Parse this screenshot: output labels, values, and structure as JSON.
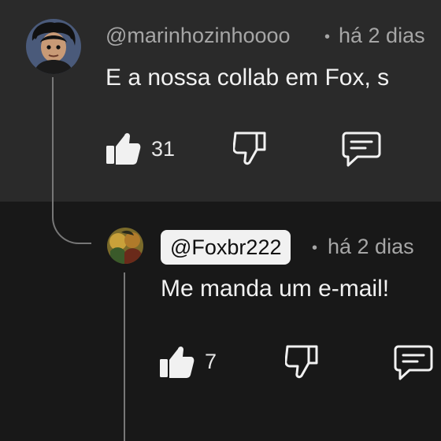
{
  "comments": [
    {
      "author": "@marinhozinhoooo",
      "separator": "•",
      "time": "há 2 dias",
      "text": "E a nossa collab em Fox, s",
      "like_count": "31",
      "icons": [
        "like-icon",
        "dislike-icon",
        "reply-icon"
      ]
    },
    {
      "author": "@Foxbr222",
      "separator": "•",
      "time": "há 2 dias",
      "text": "Me manda um e-mail!",
      "like_count": "7",
      "icons": [
        "like-icon",
        "dislike-icon",
        "reply-icon"
      ]
    }
  ],
  "colors": {
    "parent_background": "#2a2a2a",
    "reply_background": "#181818",
    "secondary_text": "#a6a6a6",
    "primary_text": "#f1f1f1",
    "author_chip": "#f1f1f1"
  }
}
